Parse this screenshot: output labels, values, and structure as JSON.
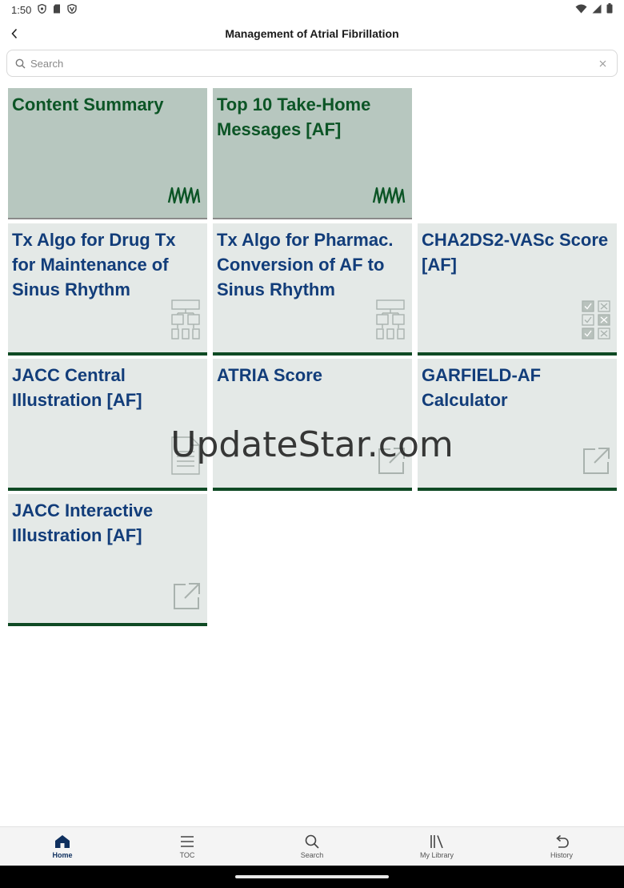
{
  "status_bar": {
    "time": "1:50"
  },
  "app_bar": {
    "title": "Management of Atrial Fibrillation"
  },
  "search": {
    "placeholder": "Search"
  },
  "tiles": [
    {
      "label": "Content Summary",
      "style": "summary",
      "icon": "ecg-wave-icon"
    },
    {
      "label": "Top 10 Take-Home Messages [AF]",
      "style": "summary",
      "icon": "ecg-wave-icon"
    },
    {
      "label": "Tx Algo for Drug Tx for Maintenance of Sinus Rhythm",
      "style": "normal",
      "icon": "flowchart-icon"
    },
    {
      "label": "Tx Algo for Pharmac. Conversion of AF to Sinus Rhythm",
      "style": "normal",
      "icon": "flowchart-icon"
    },
    {
      "label": "CHA2DS2-VASc Score [AF]",
      "style": "normal",
      "icon": "checklist-icon"
    },
    {
      "label": "JACC Central Illustration [AF]",
      "style": "normal",
      "icon": "document-icon"
    },
    {
      "label": "ATRIA Score",
      "style": "normal",
      "icon": "external-link-icon"
    },
    {
      "label": "GARFIELD-AF Calculator",
      "style": "normal",
      "icon": "external-link-icon"
    },
    {
      "label": "JACC Interactive Illustration [AF]",
      "style": "normal",
      "icon": "external-link-icon"
    }
  ],
  "watermark": "UpdateStar.com",
  "bottom_nav": [
    {
      "label": "Home",
      "icon": "home-icon",
      "active": true
    },
    {
      "label": "TOC",
      "icon": "menu-icon",
      "active": false
    },
    {
      "label": "Search",
      "icon": "search-icon",
      "active": false
    },
    {
      "label": "My Library",
      "icon": "library-icon",
      "active": false
    },
    {
      "label": "History",
      "icon": "history-icon",
      "active": false
    }
  ],
  "colors": {
    "summary_tile": "#b7c7bf",
    "summary_text": "#0c5526",
    "tile": "#e4e9e7",
    "tile_text": "#123d7a",
    "tile_bar": "#0f4a24",
    "nav_active": "#0e2f5e"
  }
}
